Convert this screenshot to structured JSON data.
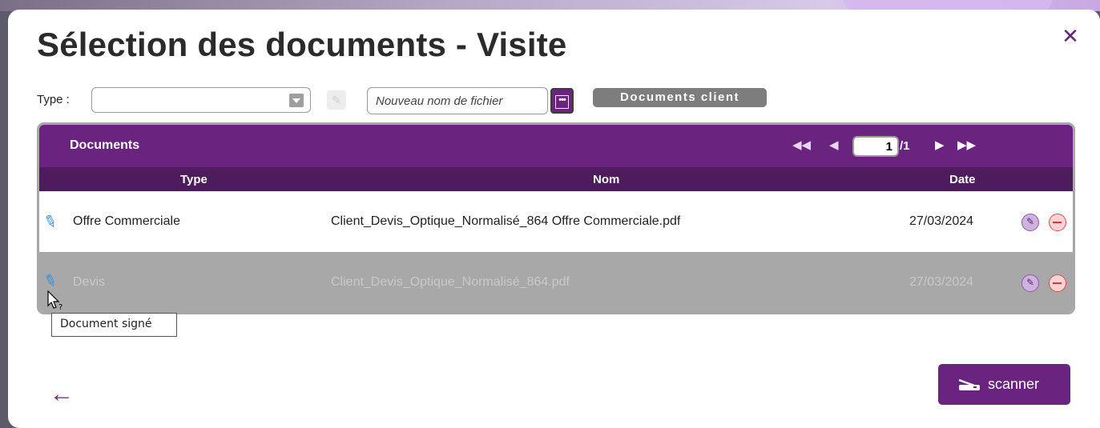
{
  "dialog": {
    "title": "Sélection des documents - Visite",
    "close_icon": "close-icon"
  },
  "toolbar": {
    "type_label": "Type :",
    "type_value": "",
    "filename_placeholder": "Nouveau nom de fichier",
    "documents_client_label": "Documents client"
  },
  "grid": {
    "caption": "Documents",
    "pager": {
      "current_page": "1",
      "total": "/1"
    },
    "columns": {
      "type": "Type",
      "nom": "Nom",
      "date": "Date"
    },
    "rows": [
      {
        "type": "Offre Commerciale",
        "nom": "Client_Devis_Optique_Normalisé_864 Offre Commerciale.pdf",
        "date": "27/03/2024",
        "signed": true
      },
      {
        "type": "Devis",
        "nom": "Client_Devis_Optique_Normalisé_864.pdf",
        "date": "27/03/2024",
        "signed": true
      }
    ]
  },
  "tooltip": {
    "text": "Document signé"
  },
  "footer": {
    "scanner_label": "scanner"
  },
  "colors": {
    "accent": "#6b2380",
    "column_header": "#4e1b5c",
    "selected_row": "#a8a8a8",
    "delete": "#e0303e"
  }
}
